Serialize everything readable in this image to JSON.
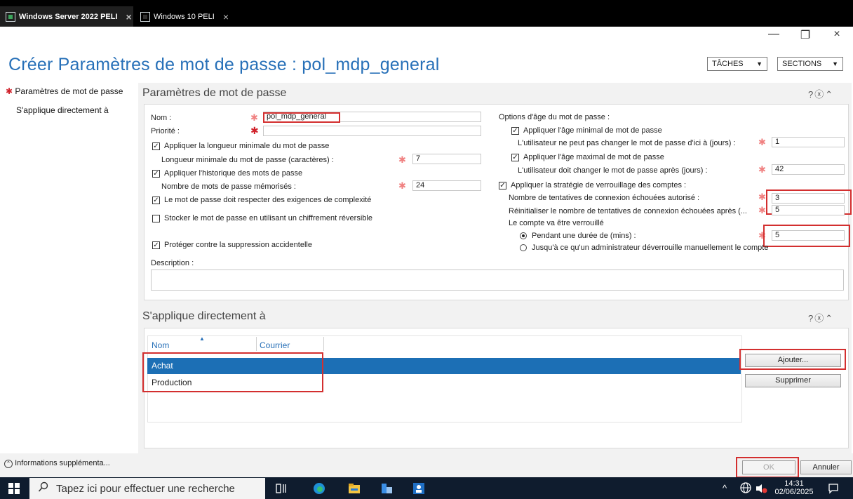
{
  "vm_tabs": [
    {
      "label": "Windows Server 2022 PELI",
      "close": "×"
    },
    {
      "label": "Windows 10 PELI",
      "close": "×"
    }
  ],
  "window_controls": {
    "minimize": "—",
    "restore": "❐",
    "close": "×"
  },
  "header": {
    "title": "Créer Paramètres de mot de passe : pol_mdp_general",
    "taches": "TÂCHES",
    "sections": "SECTIONS",
    "caret": "▼"
  },
  "nav": {
    "item1": "Paramètres de mot de passe",
    "item2": "S'applique directement à",
    "star": "✱"
  },
  "password_section": {
    "title": "Paramètres de mot de passe",
    "icons": "?ⓧ⌃",
    "name_label": "Nom :",
    "name_value": "pol_mdp_general",
    "priority_label": "Priorité :",
    "priority_value": "",
    "min_length_chk": "Appliquer la longueur minimale du mot de passe",
    "min_length_label": "Longueur minimale du mot de passe (caractères) :",
    "min_length_value": "7",
    "history_chk": "Appliquer l'historique des mots de passe",
    "history_label": "Nombre de mots de passe mémorisés :",
    "history_value": "24",
    "complexity_chk": "Le mot de passe doit respecter des exigences de complexité",
    "reversible_chk": "Stocker le mot de passe en utilisant un chiffrement réversible",
    "protect_chk": "Protéger contre la suppression accidentelle",
    "description_label": "Description :",
    "age_title": "Options d'âge du mot de passe :",
    "min_age_chk": "Appliquer l'âge minimal de mot de passe",
    "min_age_label": "L'utilisateur ne peut pas changer le mot de passe d'ici à (jours) :",
    "min_age_value": "1",
    "max_age_chk": "Appliquer l'âge maximal de mot de passe",
    "max_age_label": "L'utilisateur doit changer le mot de passe après (jours) :",
    "max_age_value": "42",
    "lockout_chk": "Appliquer la stratégie de verrouillage des comptes :",
    "attempts_label": "Nombre de tentatives de connexion échouées autorisé :",
    "attempts_value": "3",
    "reset_label": "Réinitialiser le nombre de tentatives de connexion échouées après (...",
    "reset_value": "5",
    "locked_label": "Le compte va être verrouillé",
    "duration_radio": "Pendant une durée de (mins) :",
    "duration_value": "5",
    "admin_radio": "Jusqu'à ce qu'un administrateur déverrouille manuellement le compte",
    "check": "✓"
  },
  "applies_section": {
    "title": "S'applique directement à",
    "icons": "?ⓧ⌃",
    "columns": [
      "Nom",
      "Courrier"
    ],
    "rows": [
      "Achat",
      "Production"
    ],
    "add_button": "Ajouter...",
    "remove_button": "Supprimer"
  },
  "footer": {
    "more_info": "Informations supplémenta...",
    "ok": "OK",
    "cancel": "Annuler"
  },
  "taskbar": {
    "search_placeholder": "Tapez ici pour effectuer une recherche",
    "time": "14:31",
    "date": "02/06/2025"
  },
  "colors": {
    "accent": "#2770b8",
    "selected_row": "#1c6fb5",
    "annotation_red": "#d32f2f",
    "required_star": "#d0222b"
  }
}
